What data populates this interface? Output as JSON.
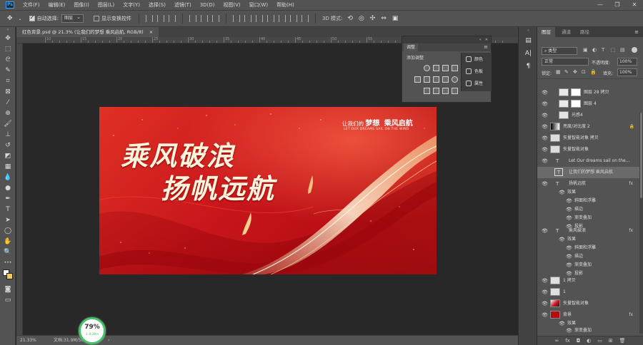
{
  "app": {
    "logo": "Ps",
    "menu": [
      "文件(F)",
      "编辑(E)",
      "图像(I)",
      "图层(L)",
      "文字(Y)",
      "选择(S)",
      "滤镜(T)",
      "3D(D)",
      "视图(V)",
      "窗口(W)",
      "帮助(H)"
    ],
    "window_controls": [
      "—",
      "❐",
      "✕"
    ]
  },
  "options": {
    "auto_select_label": "自动选择:",
    "auto_select_value": "图层",
    "show_transform_label": "显示变换控件",
    "mode_3d_label": "3D 模式:"
  },
  "document": {
    "tab_title": "红色背景.psd @ 21.3% (让我们的梦想  乘风启航, RGB/8)",
    "tab_close": "×",
    "ruler_ticks": [
      "10",
      "15",
      "20",
      "25",
      "30",
      "35",
      "40",
      "45",
      "50",
      "55",
      "60",
      "65",
      "70"
    ]
  },
  "banner": {
    "title_line1": "乘风破浪",
    "title_line2": "扬帆远航",
    "slogan_cn_prefix": "让我们的",
    "slogan_cn_bold": "梦想",
    "slogan_cn_suffix": "乘风启航",
    "slogan_en": "LET OUR DREAMS SAIL ON THE WIND"
  },
  "status": {
    "zoom": "21.33%",
    "doc_info": "文档:31.9M/503",
    "arrow": "›"
  },
  "progress": {
    "percent": 79,
    "percent_label": "79%",
    "speed": "0.2K/s"
  },
  "adjustments": {
    "tab_label": "调整",
    "add_label": "添加调整",
    "side_items": [
      "颜色",
      "色板",
      "属性"
    ]
  },
  "layers_panel": {
    "tabs": [
      "图层",
      "通道",
      "路径"
    ],
    "filter_kind": "类型",
    "blend_mode": "正常",
    "opacity_label": "不透明度:",
    "opacity_value": "100%",
    "lock_label": "锁定:",
    "fill_label": "填充:",
    "fill_value": "100%",
    "rows": [
      {
        "name": "图层 28 拷贝",
        "type": "group"
      },
      {
        "name": "图层 4",
        "type": "group"
      },
      {
        "name": "光感4",
        "type": "pixel"
      },
      {
        "name": "亮度/对比度 2",
        "type": "adjust"
      },
      {
        "name": "矢量智能对象 拷贝",
        "type": "smart"
      },
      {
        "name": "矢量智能对象",
        "type": "smart"
      },
      {
        "name": "Let Our dreams sail on the...",
        "type": "text"
      },
      {
        "name": "让我们的梦想  乘风启航",
        "type": "text"
      },
      {
        "name": "扬帆远航",
        "type": "text",
        "fx": "fx"
      },
      {
        "name": "效果",
        "type": "effect-header"
      },
      {
        "name": "斜面和浮雕",
        "type": "effect"
      },
      {
        "name": "描边",
        "type": "effect"
      },
      {
        "name": "渐变叠加",
        "type": "effect"
      },
      {
        "name": "投影",
        "type": "effect"
      },
      {
        "name": "乘风破浪",
        "type": "text",
        "fx": "fx"
      },
      {
        "name": "效果",
        "type": "effect-header"
      },
      {
        "name": "斜面和浮雕",
        "type": "effect"
      },
      {
        "name": "描边",
        "type": "effect"
      },
      {
        "name": "渐变叠加",
        "type": "effect"
      },
      {
        "name": "投影",
        "type": "effect"
      },
      {
        "name": "1 拷贝",
        "type": "pixel"
      },
      {
        "name": "1",
        "type": "pixel"
      },
      {
        "name": "矢量智能对象",
        "type": "smart-red"
      },
      {
        "name": "背景",
        "type": "bg",
        "fx": "fx"
      },
      {
        "name": "效果",
        "type": "effect-header"
      },
      {
        "name": "渐变叠加",
        "type": "effect"
      }
    ],
    "footer_icons": [
      "∞",
      "fx",
      "◘",
      "◐",
      "▭",
      "⊞",
      "🗑"
    ]
  },
  "colors": {
    "accent": "#31a8ff",
    "banner_red": "#c8161b",
    "gold": "#f6e3b0",
    "progress_green": "#43c467"
  }
}
